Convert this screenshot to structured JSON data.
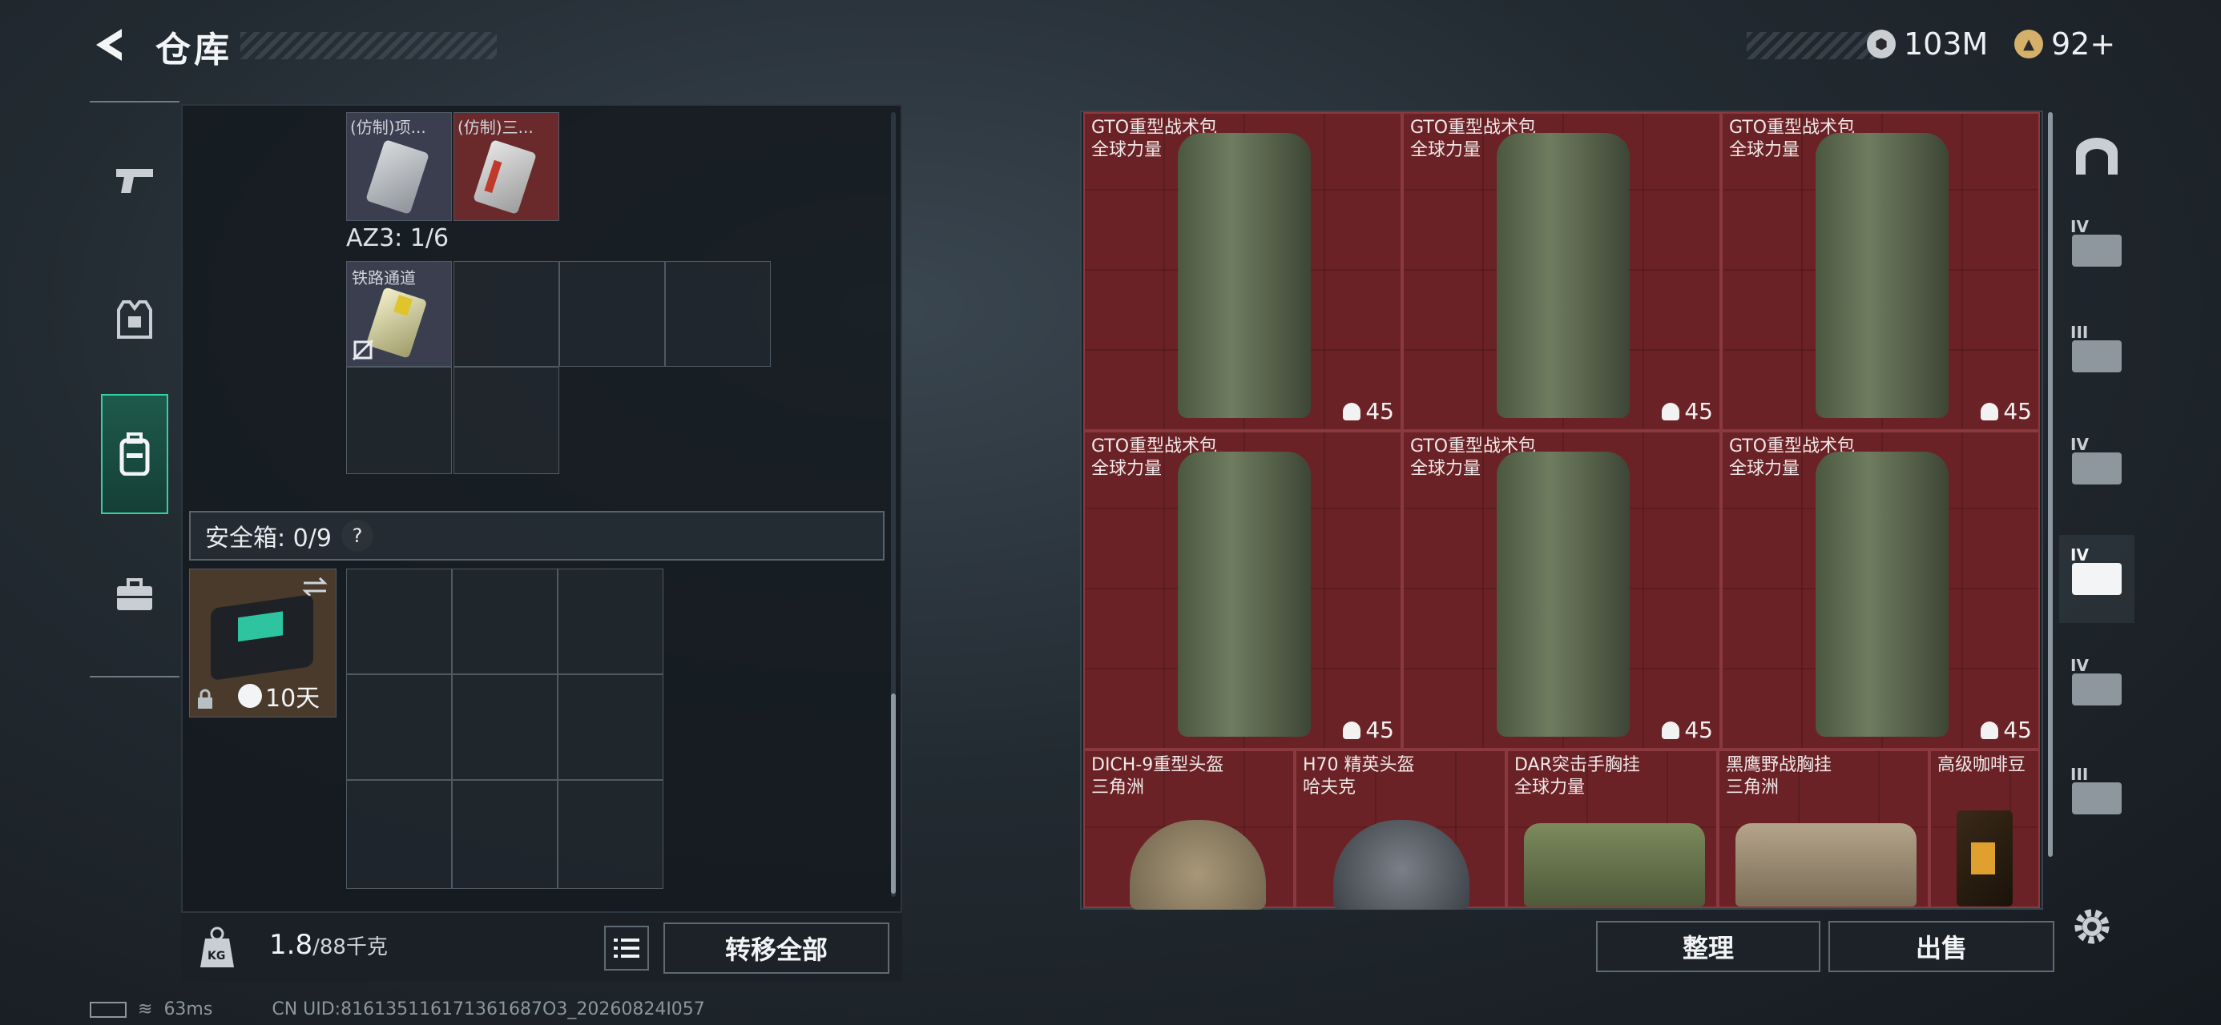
{
  "header": {
    "title": "仓库",
    "currency1": "103M",
    "currency2": "92+"
  },
  "left_nav": [
    "weapon-tab",
    "armor-tab",
    "backpack-tab",
    "case-tab"
  ],
  "storage": {
    "top_items": [
      "(仿制)项...",
      "(仿制)三..."
    ],
    "az3_label": "AZ3: 1/6",
    "railway_item": "铁路通道"
  },
  "safebox": {
    "label": "安全箱: 0/9",
    "help": "?",
    "timer": "10天"
  },
  "footer": {
    "weight": "1.8",
    "weight_max": "/88千克",
    "weight_icon_text": "KG",
    "transfer_all": "转移全部"
  },
  "market_items": [
    {
      "name": "GTO重型战术包",
      "sub": "全球力量",
      "count": "45"
    },
    {
      "name": "GTO重型战术包",
      "sub": "全球力量",
      "count": "45"
    },
    {
      "name": "GTO重型战术包",
      "sub": "全球力量",
      "count": "45"
    },
    {
      "name": "GTO重型战术包",
      "sub": "全球力量",
      "count": "45"
    },
    {
      "name": "GTO重型战术包",
      "sub": "全球力量",
      "count": "45"
    },
    {
      "name": "GTO重型战术包",
      "sub": "全球力量",
      "count": "45"
    },
    {
      "name": "DICH-9重型头盔",
      "sub": "三角洲"
    },
    {
      "name": "H70 精英头盔",
      "sub": "哈夫克"
    },
    {
      "name": "DAR突击手胸挂",
      "sub": "全球力量"
    },
    {
      "name": "黑鹰野战胸挂",
      "sub": "三角洲"
    },
    {
      "name": "高级咖啡豆",
      "sub": ""
    }
  ],
  "actions": {
    "sort": "整理",
    "sell": "出售"
  },
  "right_nav": [
    "IV",
    "III",
    "IV",
    "IV",
    "IV",
    "III"
  ],
  "status": {
    "ping": "63ms",
    "uid": "CN UID:816135116171361687O3_20260824I057"
  }
}
